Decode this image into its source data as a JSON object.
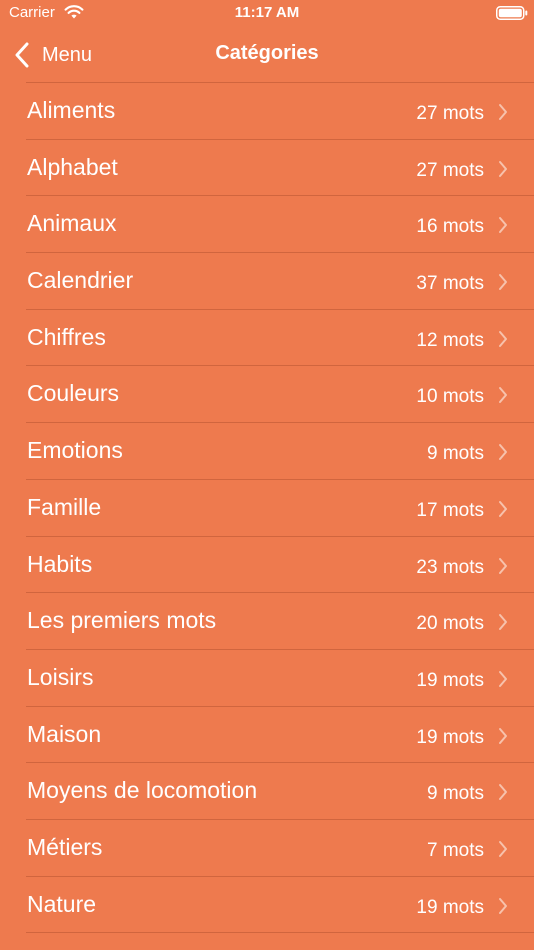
{
  "status_bar": {
    "carrier": "Carrier",
    "time": "11:17 AM",
    "wifi_icon": "wifi-icon",
    "battery_icon": "battery-icon"
  },
  "nav": {
    "back_label": "Menu",
    "back_icon": "chevron-left-icon",
    "title": "Catégories"
  },
  "colors": {
    "background": "#EE7A4E",
    "text": "#FFFFFF",
    "chevron": "#F7C2AC"
  },
  "categories": [
    {
      "label": "Aliments",
      "count": "27 mots"
    },
    {
      "label": "Alphabet",
      "count": "27 mots"
    },
    {
      "label": "Animaux",
      "count": "16 mots"
    },
    {
      "label": "Calendrier",
      "count": "37 mots"
    },
    {
      "label": "Chiffres",
      "count": "12 mots"
    },
    {
      "label": "Couleurs",
      "count": "10 mots"
    },
    {
      "label": "Emotions",
      "count": "9 mots"
    },
    {
      "label": "Famille",
      "count": "17 mots"
    },
    {
      "label": "Habits",
      "count": "23 mots"
    },
    {
      "label": "Les premiers mots",
      "count": "20 mots"
    },
    {
      "label": "Loisirs",
      "count": "19 mots"
    },
    {
      "label": "Maison",
      "count": "19 mots"
    },
    {
      "label": "Moyens de locomotion",
      "count": "9 mots"
    },
    {
      "label": "Métiers",
      "count": "7 mots"
    },
    {
      "label": "Nature",
      "count": "19 mots"
    }
  ]
}
